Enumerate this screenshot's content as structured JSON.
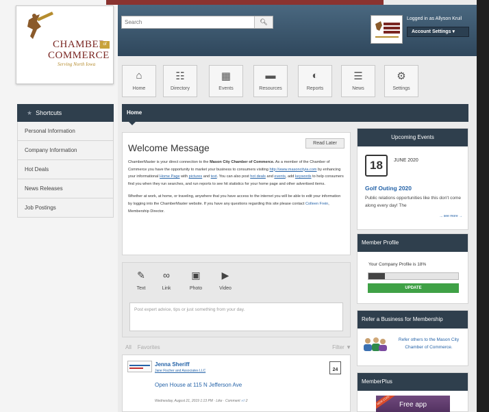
{
  "header": {
    "search_placeholder": "Search",
    "logged_in_text": "Logged in as Allyson Kruil",
    "account_settings_label": "Account Settings"
  },
  "logo": {
    "line1": "CHAMBER",
    "line2": "COMMERCE",
    "of": "of",
    "tagline": "Serving North Iowa"
  },
  "nav": [
    {
      "label": "Home",
      "icon": "home-icon",
      "glyph": "⌂"
    },
    {
      "label": "Directory",
      "icon": "directory-icon",
      "glyph": "☷"
    },
    {
      "label": "Events",
      "icon": "calendar-icon",
      "glyph": "▦"
    },
    {
      "label": "Resources",
      "icon": "folder-icon",
      "glyph": "▬"
    },
    {
      "label": "Reports",
      "icon": "pie-chart-icon",
      "glyph": "◐"
    },
    {
      "label": "News",
      "icon": "news-icon",
      "glyph": "☰"
    },
    {
      "label": "Settings",
      "icon": "gear-icon",
      "glyph": "⚙"
    }
  ],
  "sidebar": {
    "title": "Shortcuts",
    "items": [
      {
        "label": "Personal Information"
      },
      {
        "label": "Company Information"
      },
      {
        "label": "Hot Deals"
      },
      {
        "label": "News Releases"
      },
      {
        "label": "Job Postings"
      }
    ]
  },
  "main": {
    "breadcrumb": "Home",
    "welcome": {
      "title": "Welcome Message",
      "read_later": "Read Later",
      "p1_a": "ChamberMaster is your direct connection to the ",
      "p1_b": "Mason City Chamber of Commerce.",
      "p1_c": " As a member of the Chamber of Commerce you have the opportunity to market your business to consumers visiting ",
      "p1_link1": "http://www.masoncityia.com",
      "p1_d": " by enhancing your informational ",
      "p1_link2": "Home Page",
      "p1_e": " with ",
      "p1_link3": "pictures",
      "p1_f": " and ",
      "p1_link4": "text",
      "p1_g": ". You can also post ",
      "p1_link5": "hot deals",
      "p1_h": " and ",
      "p1_link6": "events",
      "p1_i": ", add ",
      "p1_link7": "keywords",
      "p1_j": " to help consumers find you when they run searches, and run reports to see hit statistics for your home page and other advertised items.",
      "p2_a": "Whether at work, at home, or traveling, anywhere that you have access to the internet you will be able to edit your information by logging into the ChamberMaster website. If you have any questions regarding this site please contact ",
      "p2_link": "Colleen Frein",
      "p2_b": ", Membership Director."
    },
    "post_tools": [
      {
        "label": "Text",
        "icon": "pencil-icon",
        "glyph": "✎"
      },
      {
        "label": "Link",
        "icon": "link-icon",
        "glyph": "∞"
      },
      {
        "label": "Photo",
        "icon": "camera-icon",
        "glyph": "▣"
      },
      {
        "label": "Video",
        "icon": "play-icon",
        "glyph": "▶"
      }
    ],
    "post_placeholder": "Post expert advice, tips or just something from your day.",
    "filters": {
      "all": "All",
      "favorites": "Favorites",
      "filter": "Filter"
    },
    "feed": {
      "name": "Jenna Sheriff",
      "company": "Jane Fischer and Associates LLC",
      "title": "Open House at 115 N Jefferson Ave",
      "meta": "Wednesday, August 21, 2019 1:13 PM · Like · Comment",
      "like_count": "2",
      "cal_day": "24"
    }
  },
  "right": {
    "upcoming": {
      "title": "Upcoming Events",
      "day": "18",
      "month": "JUNE 2020",
      "event_title": "Golf Outing 2020",
      "desc": "Public relations opportunities like this don't come along every day! The",
      "more": "... see more →"
    },
    "profile": {
      "title": "Member Profile",
      "text": "Your Company Profile is 18%",
      "percent": 18,
      "update": "UPDATE"
    },
    "refer": {
      "title": "Refer a Business for Membership",
      "text": "Refer others to the Mason City Chamber of Commerce."
    },
    "memberplus": {
      "title": "MemberPlus",
      "banner": "Free app",
      "badge": "NEW COOL"
    }
  },
  "colors": {
    "header_top": "#4a6880",
    "dark_bar": "#2f3f4d",
    "link_blue": "#2563a8",
    "brand_red": "#7a2622",
    "update_green": "#3fa146"
  }
}
